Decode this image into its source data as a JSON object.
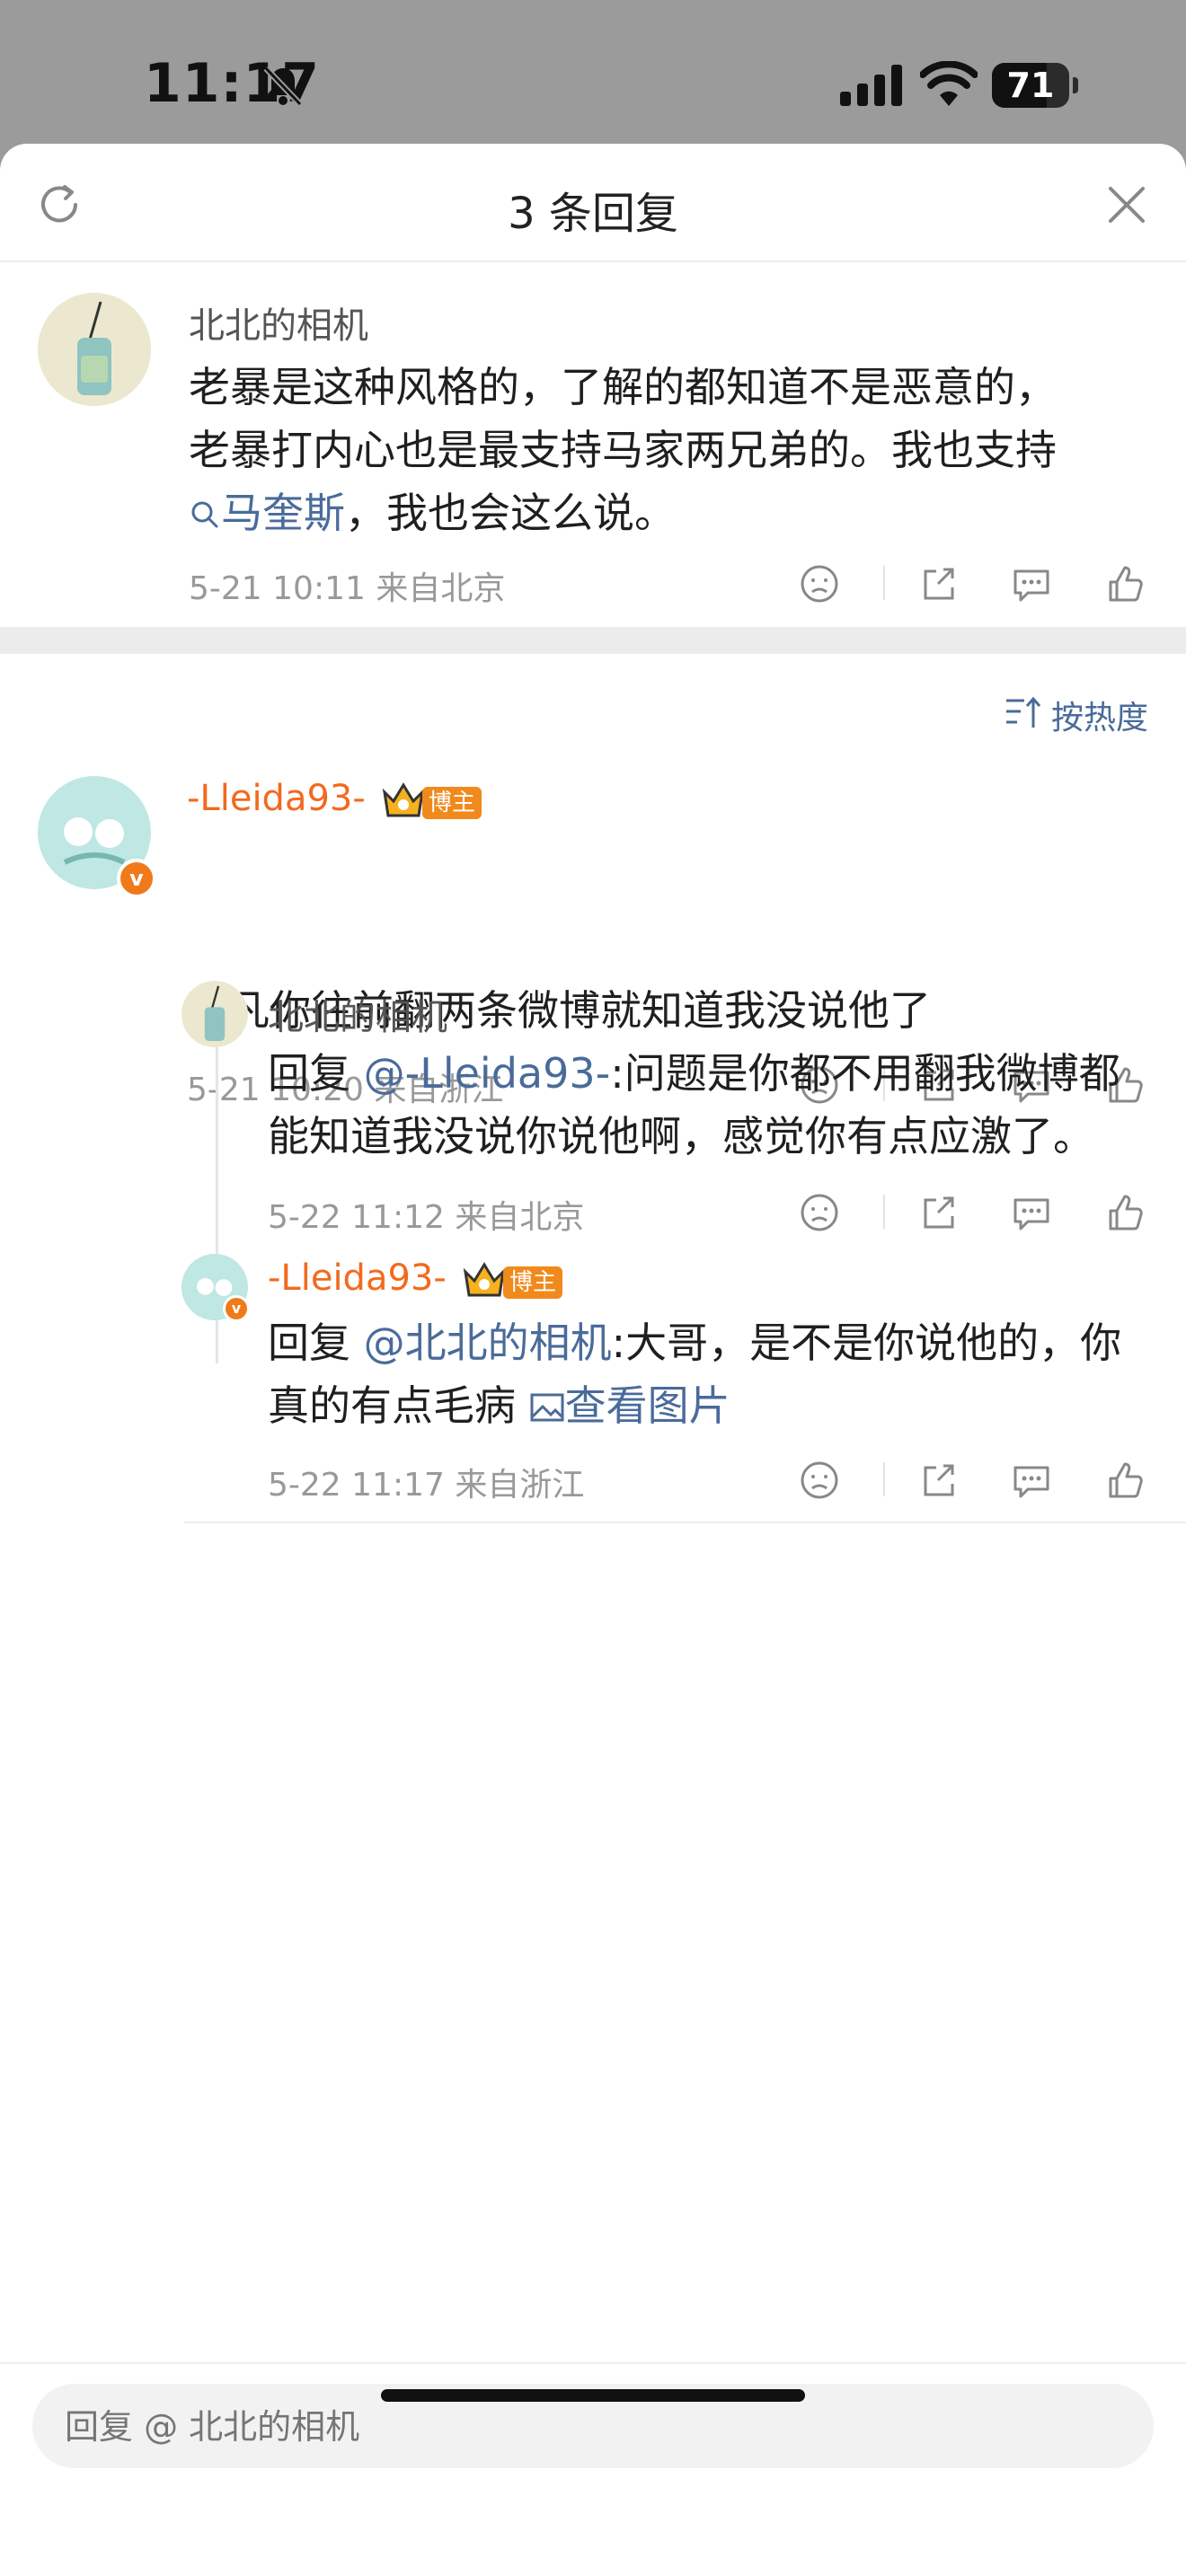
{
  "status": {
    "time": "11:17",
    "battery": "71"
  },
  "header": {
    "title": "3 条回复"
  },
  "root_comment": {
    "user": "北北的相机",
    "line1": "老暴是这种风格的，了解的都知道不是恶意的，",
    "line2": "老暴打内心也是最支持马家两兄弟的。我也支持",
    "topic": "马奎斯",
    "line3_rest": "，我也会这么说。",
    "meta": "5-21 10:11  来自北京"
  },
  "sort_label": "按热度",
  "reply1": {
    "user": "-Lleida93-",
    "badge": "博主",
    "text": "但凡你往前翻两条微博就知道我没说他了",
    "meta": "5-21 10:20  来自浙江"
  },
  "sub1": {
    "user": "北北的相机",
    "prefix": "回复 ",
    "mention": "@-Lleida93-",
    "line1_rest": ":问题是你都不用翻我微博都",
    "line2": "能知道我没说你说他啊，感觉你有点应激了。",
    "meta": "5-22 11:12  来自北京"
  },
  "sub2": {
    "user": "-Lleida93-",
    "badge": "博主",
    "prefix": "回复 ",
    "mention": "@北北的相机",
    "line1_rest": ":大哥，是不是你说他的，你",
    "line2": "真的有点毛病 ",
    "image_link": "查看图片",
    "meta": "5-22 11:17  来自浙江"
  },
  "footer": {
    "placeholder": "回复 @ 北北的相机"
  },
  "colors": {
    "accent_link": "#4a6b9a",
    "blogger_orange": "#f26a1f",
    "band": "#ececec"
  }
}
